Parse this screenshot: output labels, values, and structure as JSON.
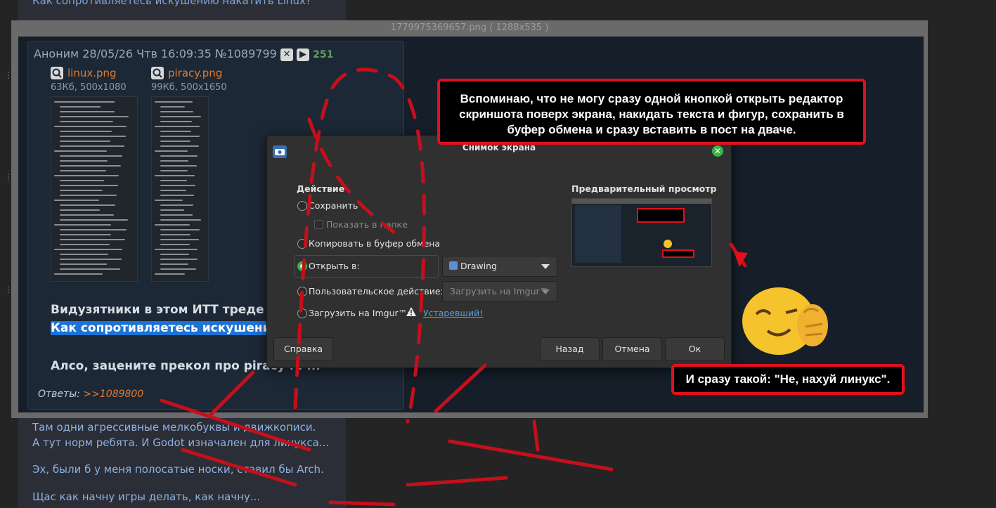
{
  "background": {
    "top_line": "Как сопротивляетесь искушению накатить Linux?",
    "lines": [
      "Там одни агрессивные мелкобуквы и движкописи.",
      "А тут норм ребята. И Godot изначален для линукса...",
      "Эх, были б у меня полосатые носки, ставил бы Arch.",
      "Щас как начну игры делать, как начну..."
    ]
  },
  "viewer": {
    "title": "1779975369657.png ( 1288x535 )"
  },
  "post": {
    "author": "Аноним",
    "datetime": "28/05/26 Чтв 16:09:35",
    "number": "№1089799",
    "count": "251",
    "files": [
      {
        "name": "linux.png",
        "info": "63Кб, 500x1080"
      },
      {
        "name": "piracy.png",
        "info": "99Кб, 500x1650"
      }
    ],
    "text_line1": "Видузятники в этом ИТТ треде при",
    "text_line2": "Как сопротивляетесь искушению н",
    "text_line3": "Алсо, зацените прекол про piracy . . ...",
    "replies_label": "Ответы:",
    "replies_link": ">>1089800"
  },
  "dialog": {
    "title": "Снимок экрана",
    "section_action": "Действие",
    "section_preview": "Предварительный просмотр",
    "opt_save": "Сохранить",
    "opt_show_in_folder": "Показать в папке",
    "opt_copy": "Копировать в буфер обмена",
    "opt_open_in": "Открыть в:",
    "open_in_app": "Drawing",
    "opt_custom": "Пользовательское действие:",
    "custom_value": "Загрузить на Imgur™",
    "opt_imgur": "Загрузить на Imgur™",
    "deprecated_link": "Устаревший!",
    "btn_help": "Справка",
    "btn_back": "Назад",
    "btn_cancel": "Отмена",
    "btn_ok": "Ок"
  },
  "annotations": {
    "note_top": "Вспоминаю, что не могу сразу одной кнопкой открыть редактор скриншота поверх экрана, накидать текста и фигур, сохранить в буфер обмена и сразу вставить в пост на дваче.",
    "note_bottom": "И сразу такой: \"Не, нахуй линукс\"."
  },
  "colors": {
    "annotation_red": "#e0101c",
    "file_link": "#e07a34",
    "highlight": "#1b73d6",
    "radio_active": "#3bb54a"
  }
}
